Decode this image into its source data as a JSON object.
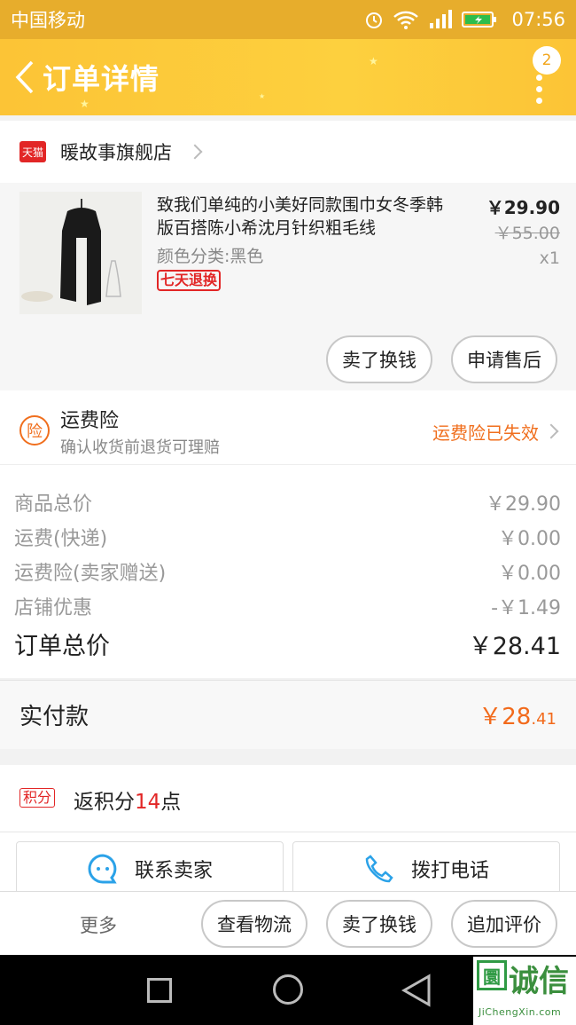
{
  "status_bar": {
    "carrier": "中国移动",
    "time": "07:56",
    "icons": [
      "alarm-icon",
      "wifi-icon",
      "signal-icon",
      "battery-icon"
    ]
  },
  "header": {
    "title": "订单详情",
    "badge_count": "2",
    "back_icon": "chevron-left-icon",
    "more_icon": "more-vertical-icon"
  },
  "store": {
    "badge": "天猫",
    "name": "暖故事旗舰店"
  },
  "product": {
    "title": "致我们单纯的小美好同款围巾女冬季韩版百搭陈小希沈月针织粗毛线",
    "sku": "颜色分类:黑色",
    "tag": "七天退换",
    "price": "￥29.90",
    "original_price": "￥55.00",
    "quantity": "x1",
    "actions": [
      "卖了换钱",
      "申请售后"
    ]
  },
  "insurance": {
    "icon_char": "险",
    "title": "运费险",
    "subtitle": "确认收货前退货可理赔",
    "status": "运费险已失效"
  },
  "costs": [
    {
      "label": "商品总价",
      "value": "￥29.90"
    },
    {
      "label": "运费(快递)",
      "value": "￥0.00"
    },
    {
      "label": "运费险(卖家赠送)",
      "value": "￥0.00"
    },
    {
      "label": "店铺优惠",
      "value": "-￥1.49"
    }
  ],
  "order_total": {
    "label": "订单总价",
    "value": "￥28.41"
  },
  "paid": {
    "label": "实付款",
    "amount_main": "￥28",
    "amount_cents": ".41"
  },
  "points": {
    "tag": "积分",
    "prefix": "返积分",
    "number": "14",
    "suffix": "点"
  },
  "contact": {
    "seller": "联系卖家",
    "call": "拨打电话"
  },
  "bottom_bar": {
    "more": "更多",
    "actions": [
      "查看物流",
      "卖了换钱",
      "追加评价"
    ]
  },
  "watermark": {
    "logo": "圜",
    "text": "诚信",
    "sub": "JiChengXin.com"
  },
  "colors": {
    "brand_yellow": "#fcc436",
    "accent_orange": "#f26a1b",
    "tmall_red": "#e22626"
  }
}
